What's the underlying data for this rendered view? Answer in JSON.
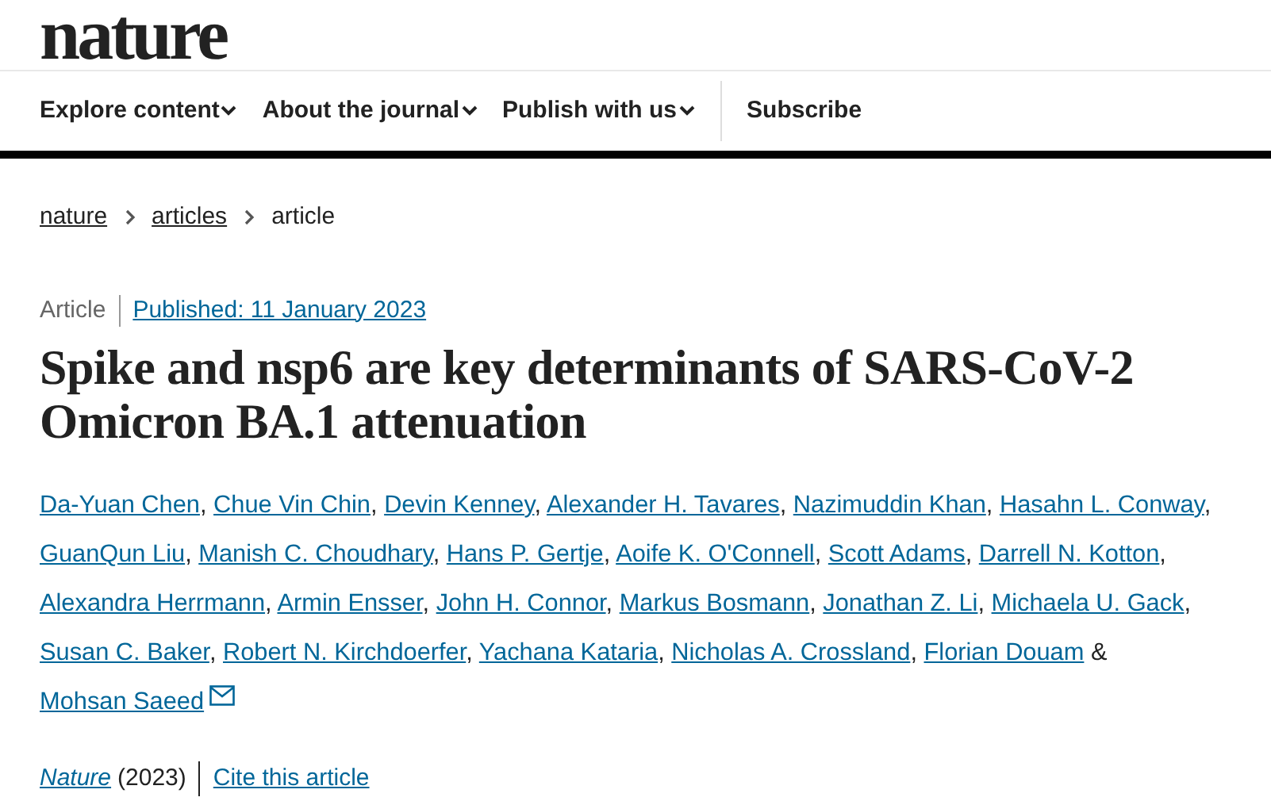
{
  "logo": "nature",
  "nav": [
    {
      "label": "Explore content",
      "kind": "dropdown"
    },
    {
      "label": "About the journal",
      "kind": "dropdown"
    },
    {
      "label": "Publish with us",
      "kind": "dropdown"
    },
    {
      "label": "Subscribe",
      "kind": "link"
    }
  ],
  "breadcrumbs": [
    {
      "label": "nature",
      "kind": "link"
    },
    {
      "label": "articles",
      "kind": "link"
    },
    {
      "label": "article",
      "kind": "current"
    }
  ],
  "article_type": "Article",
  "published": "Published: 11 January 2023",
  "title": "Spike and nsp6 are key determinants of SARS-CoV-2 Omicron BA.1 attenuation",
  "authors": [
    {
      "name": "Da-Yuan Chen",
      "separator": ",",
      "email": false
    },
    {
      "name": "Chue Vin Chin",
      "separator": ",",
      "email": false
    },
    {
      "name": "Devin Kenney",
      "separator": ",",
      "email": false
    },
    {
      "name": "Alexander H. Tavares",
      "separator": ",",
      "email": false
    },
    {
      "name": "Nazimuddin Khan",
      "separator": ",",
      "email": false
    },
    {
      "name": "Hasahn L. Conway",
      "separator": ",",
      "email": false
    },
    {
      "name": "GuanQun Liu",
      "separator": ",",
      "email": false
    },
    {
      "name": "Manish C. Choudhary",
      "separator": ",",
      "email": false
    },
    {
      "name": "Hans P. Gertje",
      "separator": ",",
      "email": false
    },
    {
      "name": "Aoife K. O'Connell",
      "separator": ",",
      "email": false
    },
    {
      "name": "Scott Adams",
      "separator": ",",
      "email": false
    },
    {
      "name": "Darrell N. Kotton",
      "separator": ",",
      "email": false
    },
    {
      "name": "Alexandra Herrmann",
      "separator": ",",
      "email": false
    },
    {
      "name": "Armin Ensser",
      "separator": ",",
      "email": false
    },
    {
      "name": "John H. Connor",
      "separator": ",",
      "email": false
    },
    {
      "name": "Markus Bosmann",
      "separator": ",",
      "email": false
    },
    {
      "name": "Jonathan Z. Li",
      "separator": ",",
      "email": false
    },
    {
      "name": "Michaela U. Gack",
      "separator": ",",
      "email": false
    },
    {
      "name": "Susan C. Baker",
      "separator": ",",
      "email": false
    },
    {
      "name": "Robert N. Kirchdoerfer",
      "separator": ",",
      "email": false
    },
    {
      "name": "Yachana Kataria",
      "separator": ",",
      "email": false
    },
    {
      "name": "Nicholas A. Crossland",
      "separator": ",",
      "email": false
    },
    {
      "name": "Florian Douam",
      "separator": "&",
      "email": false
    },
    {
      "name": "Mohsan Saeed",
      "email": true
    }
  ],
  "journal": "Nature",
  "year": "(2023)",
  "cite": "Cite this article"
}
